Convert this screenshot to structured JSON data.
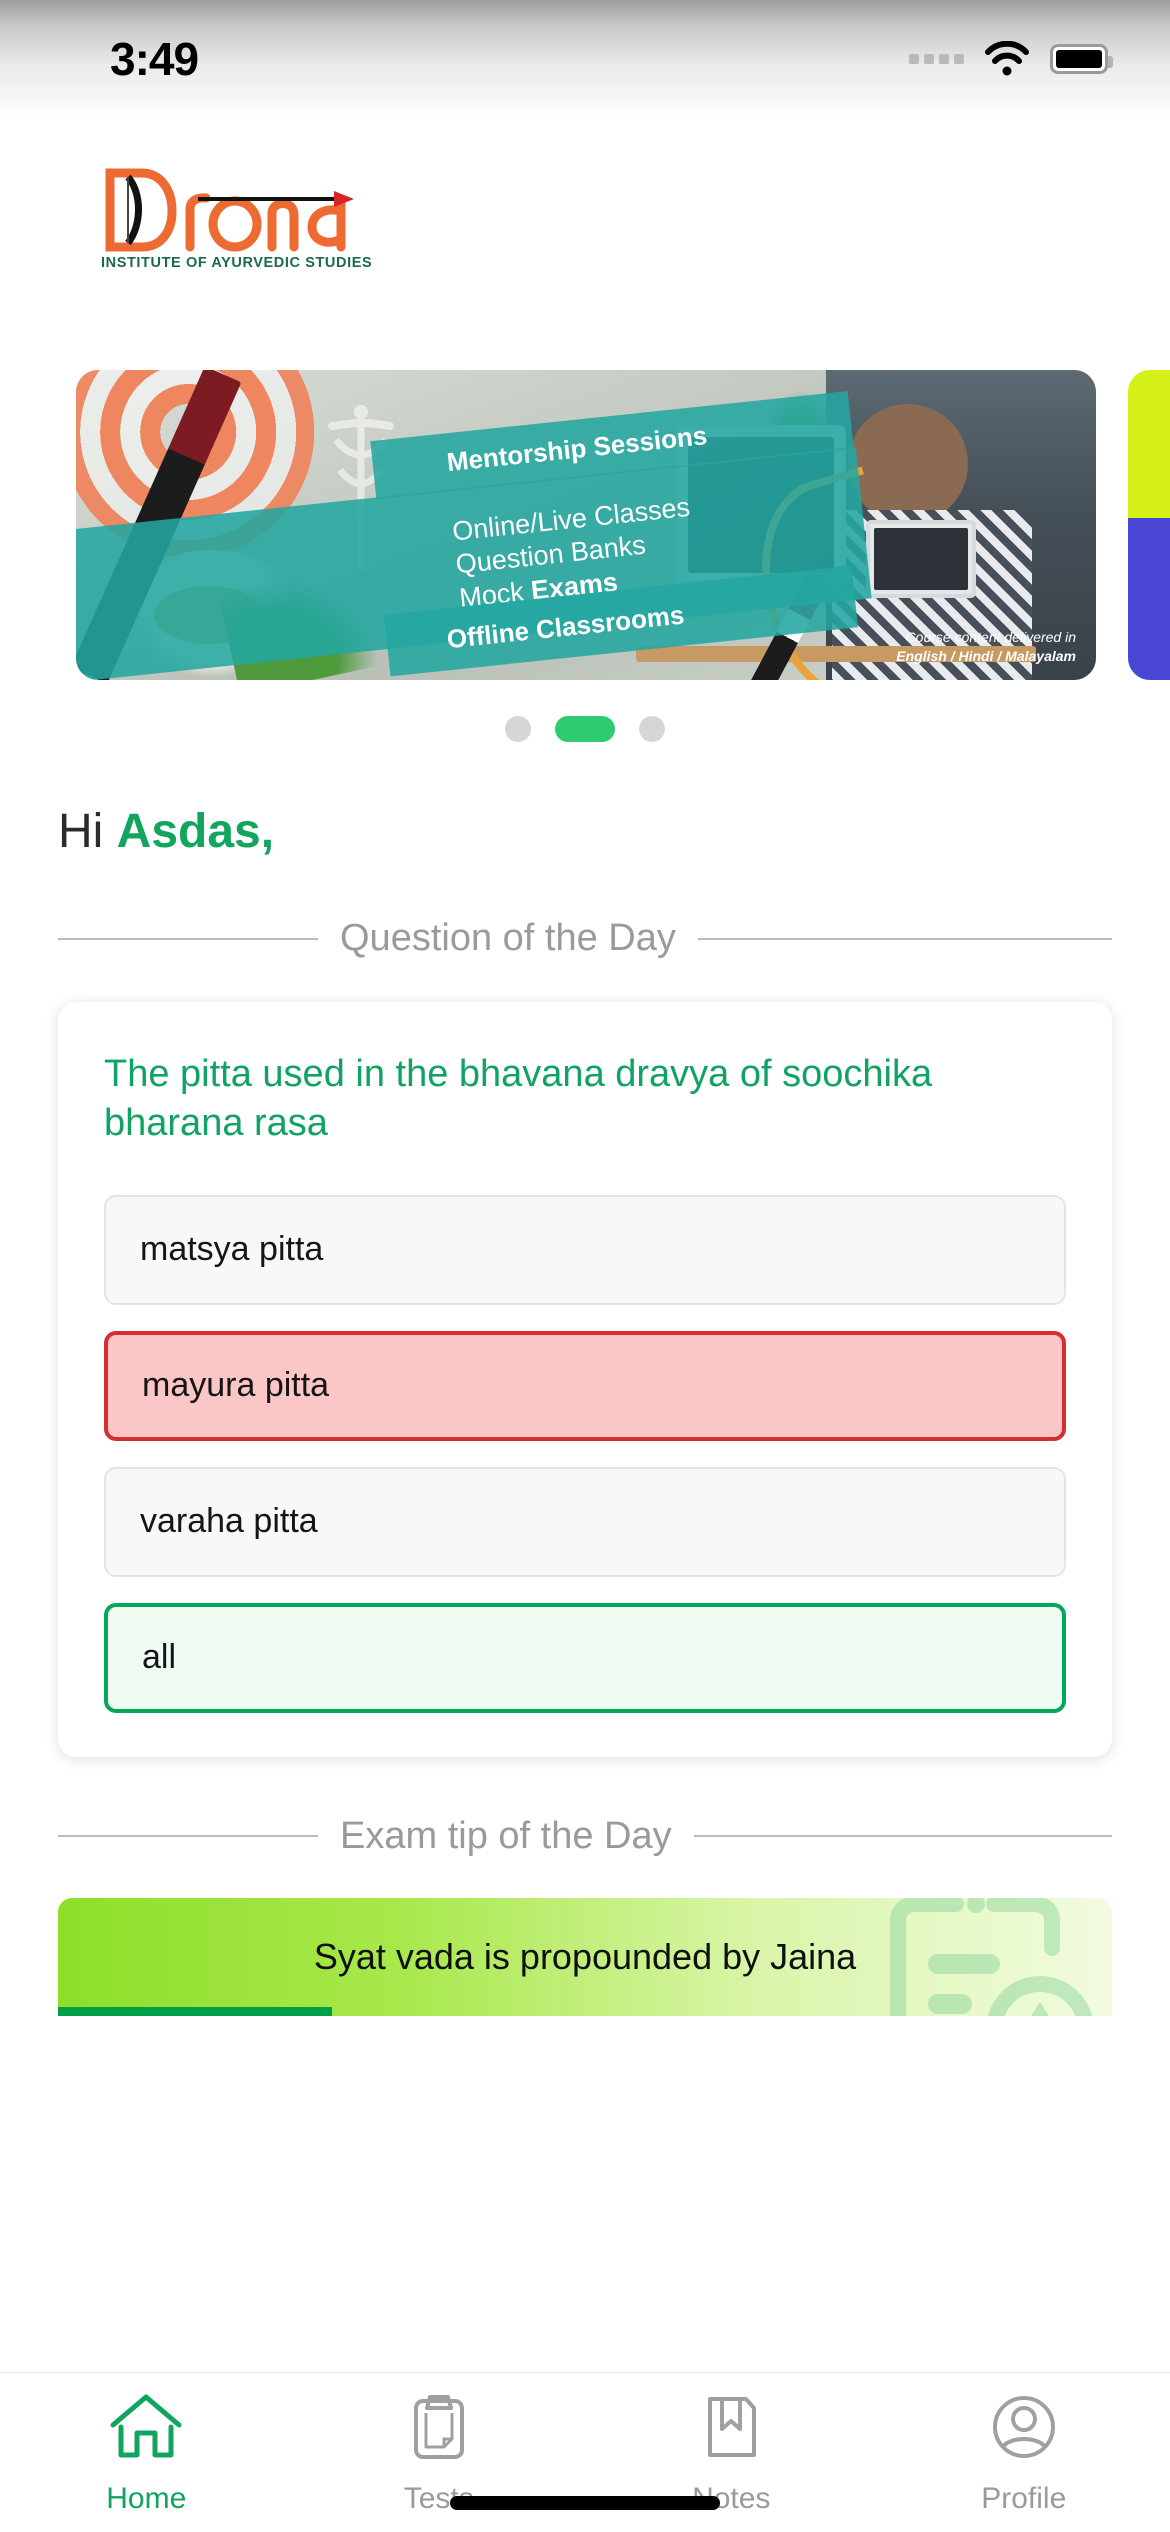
{
  "status_bar": {
    "time": "3:49",
    "signal_icon": "signal-dots-icon",
    "wifi_icon": "wifi-icon",
    "battery_icon": "battery-full-icon"
  },
  "header": {
    "logo_word": "Drona",
    "logo_tagline": "INSTITUTE OF AYURVEDIC STUDIES",
    "logo_colors": {
      "word": "#ee6a33",
      "tagline": "#1a6b4a"
    }
  },
  "carousel": {
    "current_index": 1,
    "total_slides": 3,
    "active_dot_color": "#2ecb71",
    "inactive_dot_color": "#d6d6d6",
    "slide": {
      "ribbon_1": "Mentorship Sessions",
      "ribbon_2_line_1": "Online/Live Classes",
      "ribbon_2_line_2": "Question Banks",
      "ribbon_2_line_3_normal": "Mock ",
      "ribbon_2_line_3_bold": "Exams",
      "ribbon_3": "Offline Classrooms",
      "caption_line_1": "Course content delivered in",
      "caption_line_2": "English / Hindi / Malayalam"
    }
  },
  "greeting": {
    "prefix": "Hi ",
    "name": "Asdas,"
  },
  "question_section": {
    "heading": "Question of the Day",
    "question": "The pitta used in the bhavana dravya of soochika bharana rasa",
    "question_color": "#11a363",
    "options": [
      {
        "label": "matsya pitta",
        "state": "neutral"
      },
      {
        "label": "mayura pitta",
        "state": "wrong"
      },
      {
        "label": "varaha pitta",
        "state": "neutral"
      },
      {
        "label": "all",
        "state": "correct"
      }
    ],
    "state_colors": {
      "wrong_bg": "#fac6c6",
      "wrong_border": "#d32f2f",
      "correct_bg": "#f0fbf4",
      "correct_border": "#00a859",
      "neutral_bg": "#f8f8f8",
      "neutral_border": "#e4e4e4"
    }
  },
  "exam_tip_section": {
    "heading": "Exam tip of the Day",
    "tip": "Syat vada is propounded by Jaina",
    "progress_percent": 26,
    "progress_color": "#00a04a"
  },
  "bottom_nav": {
    "active": "Home",
    "items": [
      {
        "label": "Home",
        "icon": "home-icon"
      },
      {
        "label": "Tests",
        "icon": "clipboard-icon"
      },
      {
        "label": "Notes",
        "icon": "bookmark-document-icon"
      },
      {
        "label": "Profile",
        "icon": "user-circle-icon"
      }
    ],
    "active_color": "#10a55e",
    "inactive_color": "#9a9a9a"
  }
}
